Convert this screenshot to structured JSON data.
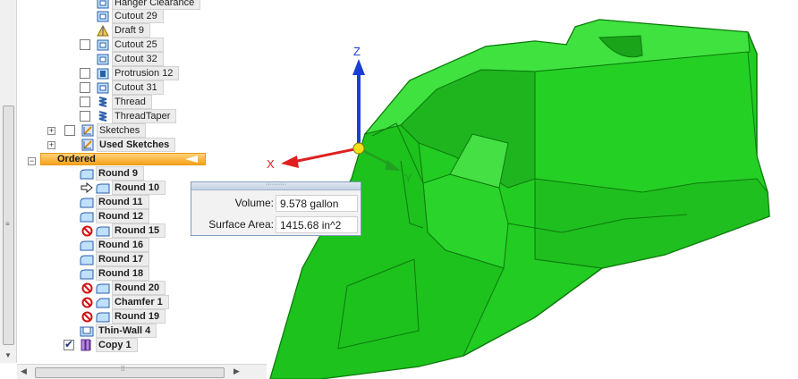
{
  "tree": {
    "items": [
      {
        "label": "Hanger Clearance",
        "icon": "cutout-icon"
      },
      {
        "label": "Cutout 29",
        "icon": "cutout-icon"
      },
      {
        "label": "Draft 9",
        "icon": "draft-icon"
      },
      {
        "label": "Cutout 25",
        "icon": "cutout-icon"
      },
      {
        "label": "Cutout 32",
        "icon": "cutout-icon"
      },
      {
        "label": "Protrusion 12",
        "icon": "protrusion-icon"
      },
      {
        "label": "Cutout 31",
        "icon": "cutout-icon"
      },
      {
        "label": "Thread",
        "icon": "thread-icon"
      },
      {
        "label": "ThreadTaper",
        "icon": "thread-icon"
      },
      {
        "label": "Sketches",
        "icon": "sketch-icon"
      },
      {
        "label": "Used Sketches",
        "icon": "sketch-icon"
      },
      {
        "label": "Ordered"
      },
      {
        "label": "Round 9",
        "icon": "round-icon"
      },
      {
        "label": "Round 10",
        "icon": "round-icon",
        "marker": "rollback-arrow-icon"
      },
      {
        "label": "Round 11",
        "icon": "round-icon"
      },
      {
        "label": "Round 12",
        "icon": "round-icon"
      },
      {
        "label": "Round 15",
        "icon": "round-icon",
        "marker": "failed-icon"
      },
      {
        "label": "Round 16",
        "icon": "round-icon"
      },
      {
        "label": "Round 17",
        "icon": "round-icon"
      },
      {
        "label": "Round 18",
        "icon": "round-icon"
      },
      {
        "label": "Round 20",
        "icon": "round-icon",
        "marker": "failed-icon"
      },
      {
        "label": "Chamfer 1",
        "icon": "chamfer-icon",
        "marker": "failed-icon"
      },
      {
        "label": "Round 19",
        "icon": "round-icon",
        "marker": "failed-icon"
      },
      {
        "label": "Thin-Wall 4",
        "icon": "thinwall-icon"
      },
      {
        "label": "Copy 1",
        "icon": "copy-part-icon",
        "checked": true
      }
    ]
  },
  "viewport": {
    "axes": {
      "x": "X",
      "y": "Y",
      "z": "Z"
    },
    "colors": {
      "part": "#22cc22",
      "part_edge": "#0d7a0d",
      "x_axis": "#e02020",
      "y_axis": "#20a020",
      "z_axis": "#1a3fd0",
      "ordered_highlight": "#f6a21a"
    }
  },
  "measure": {
    "volume_label": "Volume:",
    "volume_value": "9.578 gallon",
    "area_label": "Surface Area:",
    "area_value": "1415.68 in^2"
  }
}
